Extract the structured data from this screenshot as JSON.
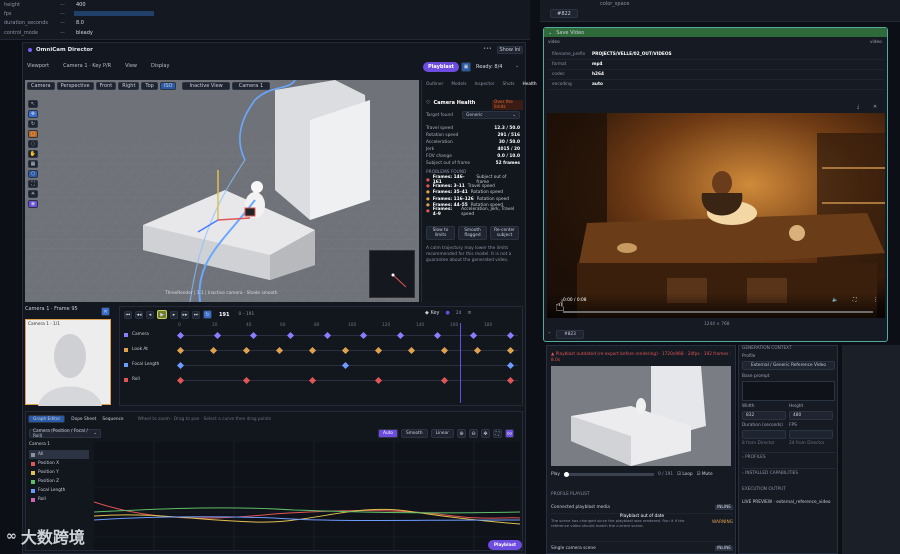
{
  "props": [
    {
      "k": "height",
      "v": "400"
    },
    {
      "k": "fps",
      "v": "24"
    },
    {
      "k": "duration_seconds",
      "v": "8.0"
    },
    {
      "k": "control_mode",
      "v": "bleady"
    }
  ],
  "node_right_top": {
    "label": "color_space",
    "badge": "#822"
  },
  "director": {
    "title": "OmniCam Director",
    "show_btn": "Show Ini",
    "menus": [
      "Viewport",
      "Camera 1 · Key P/R",
      "View",
      "Display"
    ],
    "playblast": "Playblast",
    "ready": "Ready: 8/4",
    "vp_tabs": [
      "Camera",
      "Perspective",
      "Front",
      "Right",
      "Top",
      "ISO"
    ],
    "vp_selects": [
      "Inactive View",
      "Camera 1"
    ],
    "status_text": "ThreeRender  |  1:1  |  Inactive camera · Shade smooth"
  },
  "health": {
    "tabs": [
      "Outliner",
      "Models",
      "Inspector",
      "Shots",
      "Health"
    ],
    "title": "Camera Health",
    "badge": "Over the limits",
    "target_label": "Target found",
    "target_value": "Generic",
    "metrics": [
      {
        "k": "Travel speed",
        "v": "12.3 / 50.0"
      },
      {
        "k": "Rotation speed",
        "v": "291 / 516"
      },
      {
        "k": "Acceleration",
        "v": "30 / 50.0"
      },
      {
        "k": "Jerk",
        "v": "4015 / 20"
      },
      {
        "k": "FOV change",
        "v": "0.0 / 10.0"
      },
      {
        "k": "Subject out of frame",
        "v": "52 frames"
      }
    ],
    "issues_title": "PROBLEMS FOUND",
    "issues": [
      {
        "f": "Frames: 146–161",
        "t": "Subject out of frame"
      },
      {
        "f": "Frames: 3–11",
        "t": "Travel speed"
      },
      {
        "f": "Frames: 35–41",
        "t": "Rotation speed"
      },
      {
        "f": "Frames: 116–126",
        "t": "Rotation speed"
      },
      {
        "f": "Frames: 44–55",
        "t": "Rotation speed"
      },
      {
        "f": "Frames: 4–9",
        "t": "Acceleration, Jerk, Travel speed"
      }
    ],
    "actions": [
      "Slow to limits",
      "Smooth flagged",
      "Re-center subject"
    ],
    "note": "A calm trajectory may lower the limits recommended for this model. It is not a guarantee about the generated video."
  },
  "camview": {
    "title": "Camera 1 · Frame 95",
    "label": "Camera 1 · 1/1"
  },
  "timeline": {
    "frame": "191",
    "range": "0 – 191",
    "key": "Key",
    "fps": "24",
    "ticks": [
      "0",
      "20",
      "40",
      "60",
      "80",
      "100",
      "120",
      "140",
      "160",
      "180"
    ],
    "tracks": [
      "Camera",
      "Look At",
      "Focal Length",
      "Roll"
    ]
  },
  "graph": {
    "tabs": [
      "Graph Editor",
      "Dope Sheet",
      "Sequence"
    ],
    "hint": "Wheel to zoom · Drag to pan · Select a curve then drag points",
    "camera_select": "Camera (Position / Focal / Roll)",
    "mode_btns": [
      "Auto",
      "Smooth",
      "Linear"
    ],
    "channels": [
      "All",
      "Position X",
      "Position Y",
      "Position Z",
      "Focal Length",
      "Roll"
    ],
    "channel_colors": [
      "#8a92a3",
      "#e05555",
      "#e0c14f",
      "#5fbf6a",
      "#6b9bff",
      "#d55fb3"
    ],
    "tree": [
      "Camera 1"
    ],
    "playblast": "Playblast"
  },
  "save_video": {
    "header": "Save Video",
    "video_label": "video",
    "video_out": "video",
    "fields": [
      {
        "k": "filename_prefix",
        "v": "PROJECTS/VELLE/02_OUT/VIDEOS"
      },
      {
        "k": "format",
        "v": "mp4"
      },
      {
        "k": "codec",
        "v": "h264"
      },
      {
        "k": "encoding",
        "v": "auto"
      }
    ],
    "time": "0:00 / 0:08",
    "size": "1244 × 768",
    "badge": "#823"
  },
  "preview": {
    "warn": "▲ Playblast outdated (re-export before rendering) · 1720x968 · 24fps · 192 frames · 8.0s",
    "play": "Play",
    "counter": "0 / 191",
    "loop": "Loop",
    "mute": "Mute",
    "section": "PROFILE PLAYLIST",
    "items": [
      {
        "t": "Connected playblast media",
        "badge": "INLINE"
      },
      {
        "t": "Playblast out of date",
        "badge": "WARNING",
        "desc": "The scene has changed since the playblast was rendered. Run it if the reference video should match the current scene."
      },
      {
        "t": "Single camera scene",
        "badge": "INLINE"
      }
    ]
  },
  "config": {
    "header": "GENERATION CONTEXT",
    "profile_label": "Profile",
    "profile_value": "External / Generic Reference Video",
    "prompt_label": "Base prompt",
    "width_label": "Width",
    "width": "832",
    "height_label": "Height",
    "height": "480",
    "duration_label": "Duration (seconds)",
    "duration": "",
    "fps_label": "FPS",
    "fps": "",
    "chips": [
      "8 from Director",
      "24 from Director"
    ],
    "sections": [
      "PROFILES",
      "INSTALLED CAPABILITIES"
    ],
    "exec_title": "EXECUTION OUTPUT",
    "exec_text": "LIVE PREVIEW · external_reference_video"
  },
  "watermark": "大数跨境"
}
